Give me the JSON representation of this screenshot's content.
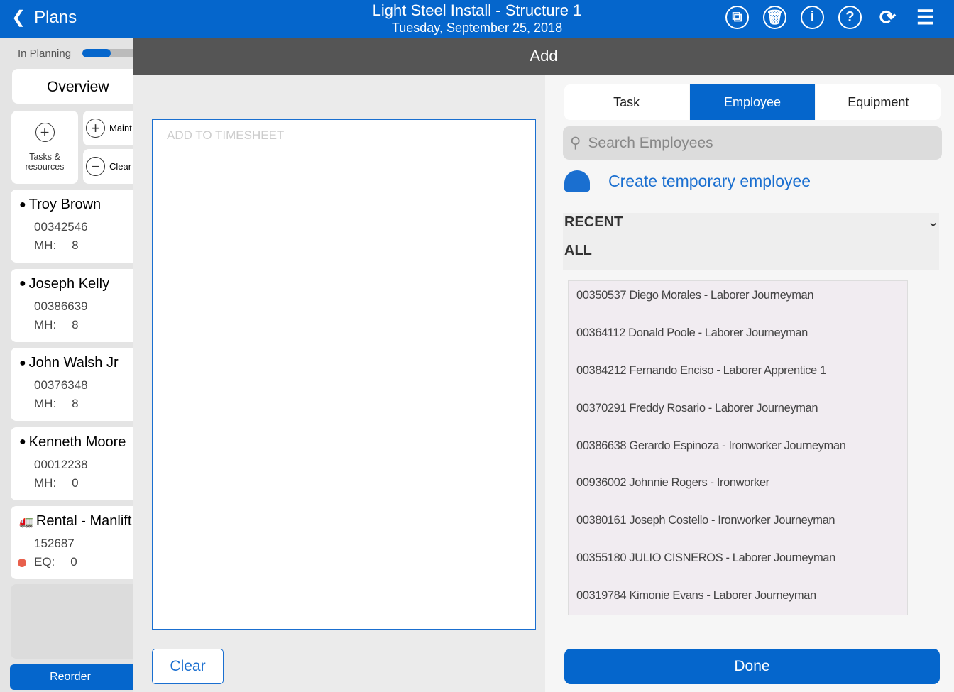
{
  "header": {
    "back_label": "Plans",
    "title": "Light Steel Install - Structure 1",
    "date": "Tuesday, September 25, 2018"
  },
  "sidebar": {
    "status": "In Planning",
    "progress_percent": 50,
    "overview": "Overview",
    "tasks_resources": "Tasks & resources",
    "maint": "Maint",
    "clear": "Clear l",
    "cards": [
      {
        "name": "Troy Brown",
        "id": "00342546",
        "label": "MH:",
        "value": "8",
        "type": "employee"
      },
      {
        "name": "Joseph Kelly",
        "id": "00386639",
        "label": "MH:",
        "value": "8",
        "type": "employee"
      },
      {
        "name": "John Walsh Jr",
        "id": "00376348",
        "label": "MH:",
        "value": "8",
        "type": "employee"
      },
      {
        "name": "Kenneth Moore",
        "id": "00012238",
        "label": "MH:",
        "value": "0",
        "type": "employee"
      },
      {
        "name": "Rental - Manlift",
        "id": "152687",
        "label": "EQ:",
        "value": "0",
        "type": "equipment"
      }
    ],
    "reorder": "Reorder"
  },
  "add_title": "Add",
  "timesheet": {
    "placeholder": "ADD TO TIMESHEET",
    "clear": "Clear"
  },
  "tabs": [
    "Task",
    "Employee",
    "Equipment"
  ],
  "search_placeholder": "Search Employees",
  "create_temp": "Create temporary employee",
  "recent": "RECENT",
  "all": "ALL",
  "employees": [
    "00350537 Diego Morales - Laborer Journeyman",
    "00364112 Donald Poole - Laborer Journeyman",
    "00384212 Fernando Enciso - Laborer Apprentice 1",
    "00370291 Freddy Rosario - Laborer Journeyman",
    "00386638 Gerardo Espinoza - Ironworker Journeyman",
    "00936002 Johnnie Rogers - Ironworker",
    "00380161 Joseph Costello - Ironworker Journeyman",
    "00355180 JULIO CISNEROS - Laborer Journeyman",
    "00319784 Kimonie Evans - Laborer Journeyman"
  ],
  "done": "Done"
}
